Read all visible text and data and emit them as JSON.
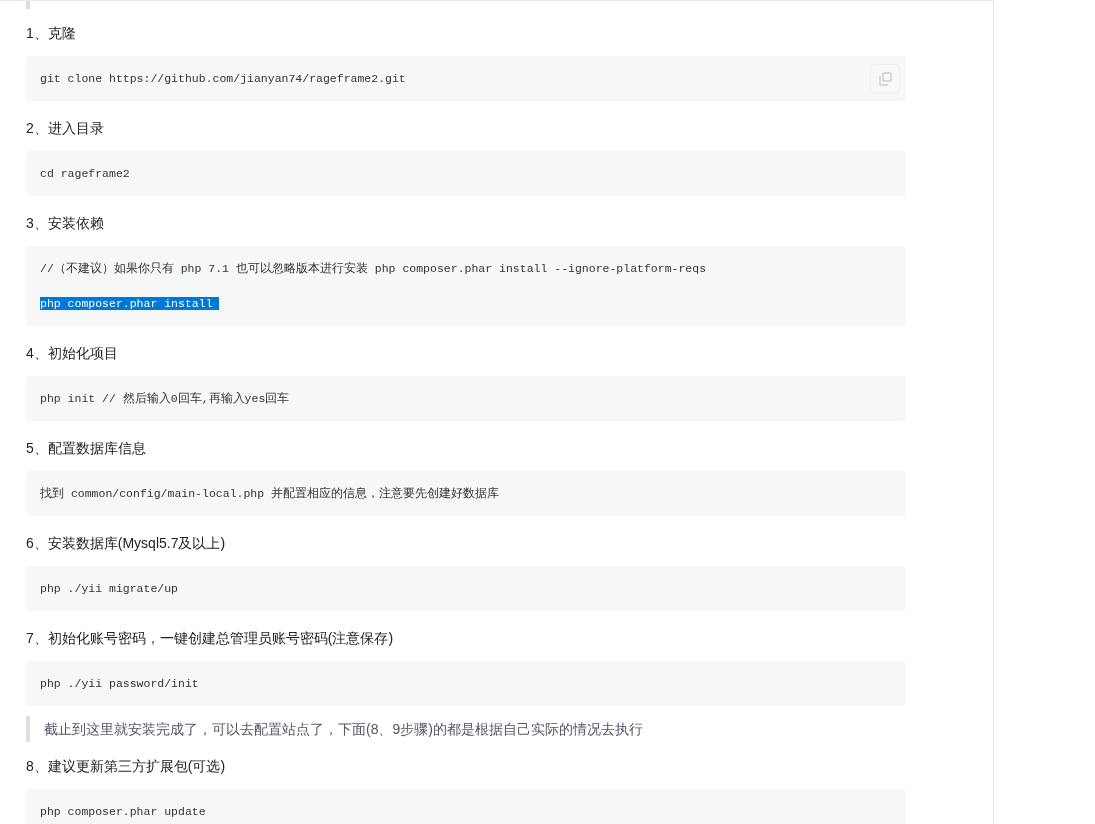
{
  "blocks": [
    {
      "kind": "heading",
      "text": "1、克隆"
    },
    {
      "kind": "code",
      "copy_button": true,
      "lines": [
        {
          "text": "git clone https://github.com/jianyan74/rageframe2.git",
          "selected": false
        }
      ]
    },
    {
      "kind": "heading",
      "text": "2、进入目录"
    },
    {
      "kind": "code",
      "copy_button": false,
      "lines": [
        {
          "text": "cd rageframe2",
          "selected": false
        }
      ]
    },
    {
      "kind": "heading",
      "text": "3、安装依赖"
    },
    {
      "kind": "code",
      "copy_button": false,
      "lines": [
        {
          "text": "//（不建议）如果你只有 php 7.1 也可以忽略版本进行安装 php composer.phar install --ignore-platform-reqs",
          "selected": false
        },
        {
          "text": "php composer.phar install",
          "selected": true
        }
      ]
    },
    {
      "kind": "heading",
      "text": "4、初始化项目"
    },
    {
      "kind": "code",
      "copy_button": false,
      "lines": [
        {
          "text": "php init // 然后输入0回车,再输入yes回车",
          "selected": false
        }
      ]
    },
    {
      "kind": "heading",
      "text": "5、配置数据库信息"
    },
    {
      "kind": "code",
      "copy_button": false,
      "lines": [
        {
          "text": "找到 common/config/main-local.php 并配置相应的信息，注意要先创建好数据库",
          "selected": false
        }
      ]
    },
    {
      "kind": "heading",
      "text": "6、安装数据库(Mysql5.7及以上)"
    },
    {
      "kind": "code",
      "copy_button": false,
      "lines": [
        {
          "text": "php ./yii migrate/up",
          "selected": false
        }
      ]
    },
    {
      "kind": "heading",
      "text": "7、初始化账号密码，一键创建总管理员账号密码(注意保存)"
    },
    {
      "kind": "code",
      "copy_button": false,
      "lines": [
        {
          "text": "php ./yii password/init",
          "selected": false
        }
      ]
    },
    {
      "kind": "quote",
      "text": "截止到这里就安装完成了，可以去配置站点了，下面(8、9步骤)的都是根据自己实际的情况去执行"
    },
    {
      "kind": "heading",
      "text": "8、建议更新第三方扩展包(可选)"
    },
    {
      "kind": "code",
      "copy_button": false,
      "lines": [
        {
          "text": "php composer.phar update",
          "selected": false
        }
      ]
    }
  ]
}
